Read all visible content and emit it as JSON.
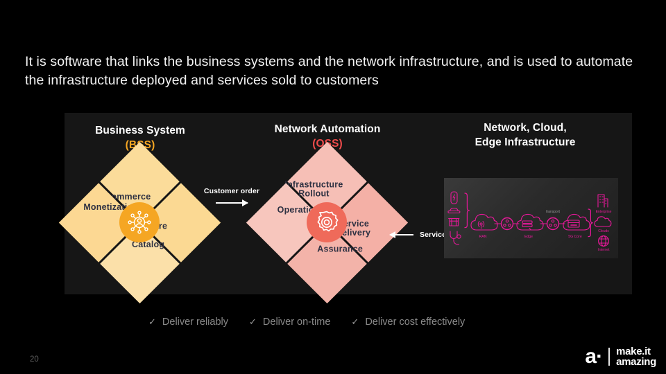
{
  "slide": {
    "headline": "It is software that links the business systems and the network infrastructure, and is used to automate the infrastructure deployed and services sold to customers",
    "page_number": "20"
  },
  "columns": {
    "bss": {
      "title": "Business System",
      "subtitle": "(BSS)",
      "accent": "#f5a623"
    },
    "oss": {
      "title": "Network Automation",
      "subtitle": "(OSS)",
      "accent": "#ef4b4b"
    },
    "network": {
      "title_line1": "Network, Cloud,",
      "title_line2": "Edge Infrastructure"
    }
  },
  "bss_diamond": {
    "fill": "#fbdc9a",
    "hub_color": "#f5a623",
    "hub_icon": "customer-network-hub-icon",
    "quadrants": [
      {
        "label": "Commerce",
        "position": "top-left"
      },
      {
        "label": "Care",
        "position": "top-right"
      },
      {
        "label": "Monetization",
        "position": "bottom-left"
      },
      {
        "label": "Catalog",
        "position": "bottom-right"
      }
    ]
  },
  "oss_diamond": {
    "fill": "#f4b4aa",
    "hub_color": "#ef6a5a",
    "hub_icon": "gear-icon",
    "quadrants": [
      {
        "label_line1": "Infrastructure",
        "label_line2": "Rollout",
        "position": "top-left"
      },
      {
        "label_line1": "Service",
        "label_line2": "Delivery",
        "position": "top-right"
      },
      {
        "label_line1": "Operations",
        "label_line2": "",
        "position": "bottom-left"
      },
      {
        "label_line1": "Assurance",
        "label_line2": "",
        "position": "bottom-right"
      }
    ]
  },
  "flows": {
    "customer_order": "Customer order",
    "service": "Service"
  },
  "network_panel": {
    "accent": "#e8189a",
    "left_devices": [
      "mobile-phone-icon",
      "car-icon",
      "factory-icon",
      "healthcare-icon"
    ],
    "nodes": [
      {
        "label": "RAN",
        "icon": "cloud-antenna-icon"
      },
      {
        "label": "Edge",
        "icon": "cloud-server-icon"
      },
      {
        "label": "5G Core",
        "icon": "cloud-datacenter-icon"
      }
    ],
    "transport_label": "transport",
    "right_targets": [
      {
        "label": "Enterprise",
        "icon": "building-icon"
      },
      {
        "label": "Clouds",
        "icon": "cloud-icon"
      },
      {
        "label": "Internet",
        "icon": "globe-icon"
      }
    ]
  },
  "bullets": [
    {
      "check": "✓",
      "label": "Deliver reliably"
    },
    {
      "check": "✓",
      "label": "Deliver on-time"
    },
    {
      "check": "✓",
      "label": "Deliver cost effectively"
    }
  ],
  "logo": {
    "mark": "a·",
    "line1": "make.it",
    "line2": "amazing"
  }
}
